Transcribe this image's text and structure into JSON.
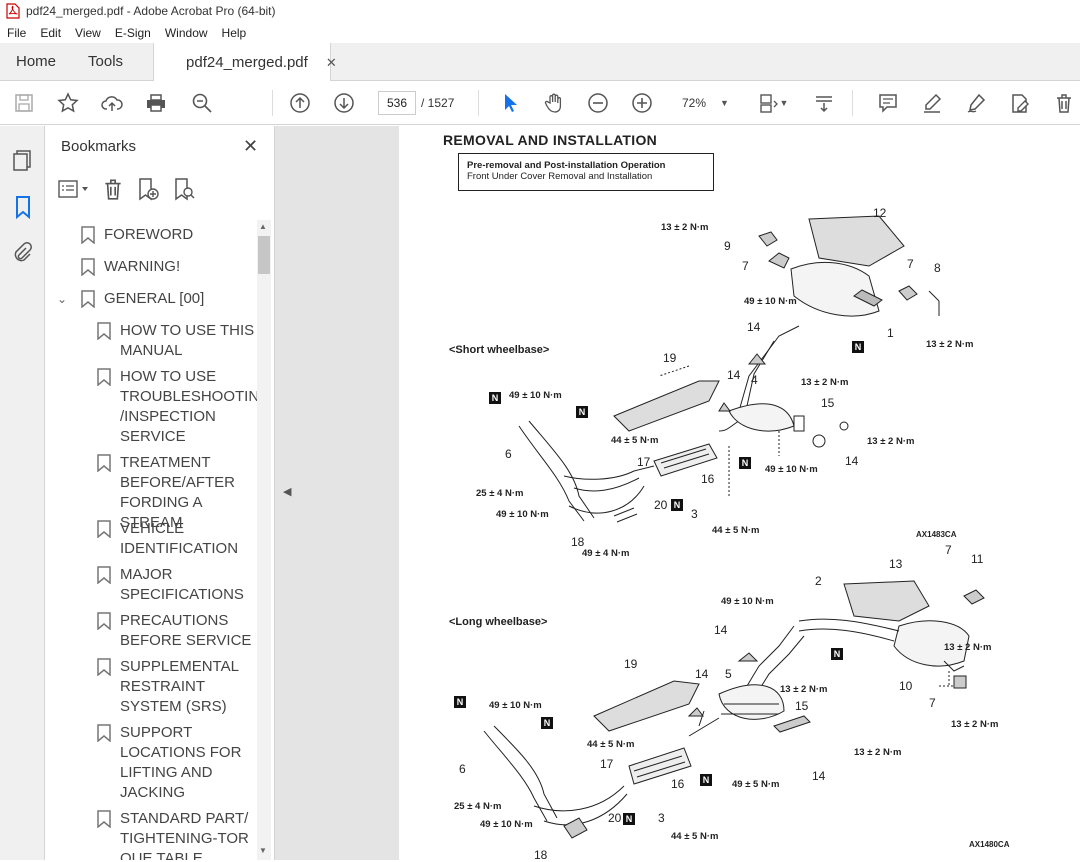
{
  "window": {
    "title": "pdf24_merged.pdf - Adobe Acrobat Pro (64-bit)"
  },
  "menu": [
    "File",
    "Edit",
    "View",
    "E-Sign",
    "Window",
    "Help"
  ],
  "tabs": {
    "home": "Home",
    "tools": "Tools",
    "doc": "pdf24_merged.pdf"
  },
  "toolbar": {
    "page_current": "536",
    "page_total": "/ 1527",
    "zoom": "72%"
  },
  "bookmarks": {
    "title": "Bookmarks",
    "items": [
      {
        "label": "FOREWORD"
      },
      {
        "label": "WARNING!"
      },
      {
        "label": "GENERAL [00]"
      },
      {
        "label": "HOW TO USE THIS MANUAL"
      },
      {
        "label": "HOW TO USE TROUBLESHOOTING /INSPECTION SERVICE"
      },
      {
        "label": "TREATMENT BEFORE/AFTER FORDING A STREAM"
      },
      {
        "label": "VEHICLE IDENTIFICATION"
      },
      {
        "label": "MAJOR SPECIFICATIONS"
      },
      {
        "label": "PRECAUTIONS BEFORE SERVICE"
      },
      {
        "label": "SUPPLEMENTAL RESTRAINT SYSTEM (SRS)"
      },
      {
        "label": "SUPPORT LOCATIONS FOR LIFTING AND JACKING"
      },
      {
        "label": "STANDARD PART/TIGHTENING-TORQUE TABLE"
      }
    ]
  },
  "page": {
    "heading": "REMOVAL AND INSTALLATION",
    "box_title": "Pre-removal and Post-installation Operation",
    "box_line": "Front Under Cover Removal and Installation",
    "short_wb": "<Short wheelbase>",
    "long_wb": "<Long wheelbase>",
    "code1": "AX1483CA",
    "code2": "AX1480CA",
    "torque_13": "13 ± 2 N·m",
    "torque_49_10": "49 ± 10 N·m",
    "torque_44_5": "44 ± 5 N·m",
    "torque_25_4": "25 ± 4 N·m",
    "torque_49_4": "49 ± 4 N·m",
    "torque_49_5": "49 ± 5 N·m",
    "n_mark": "N"
  }
}
